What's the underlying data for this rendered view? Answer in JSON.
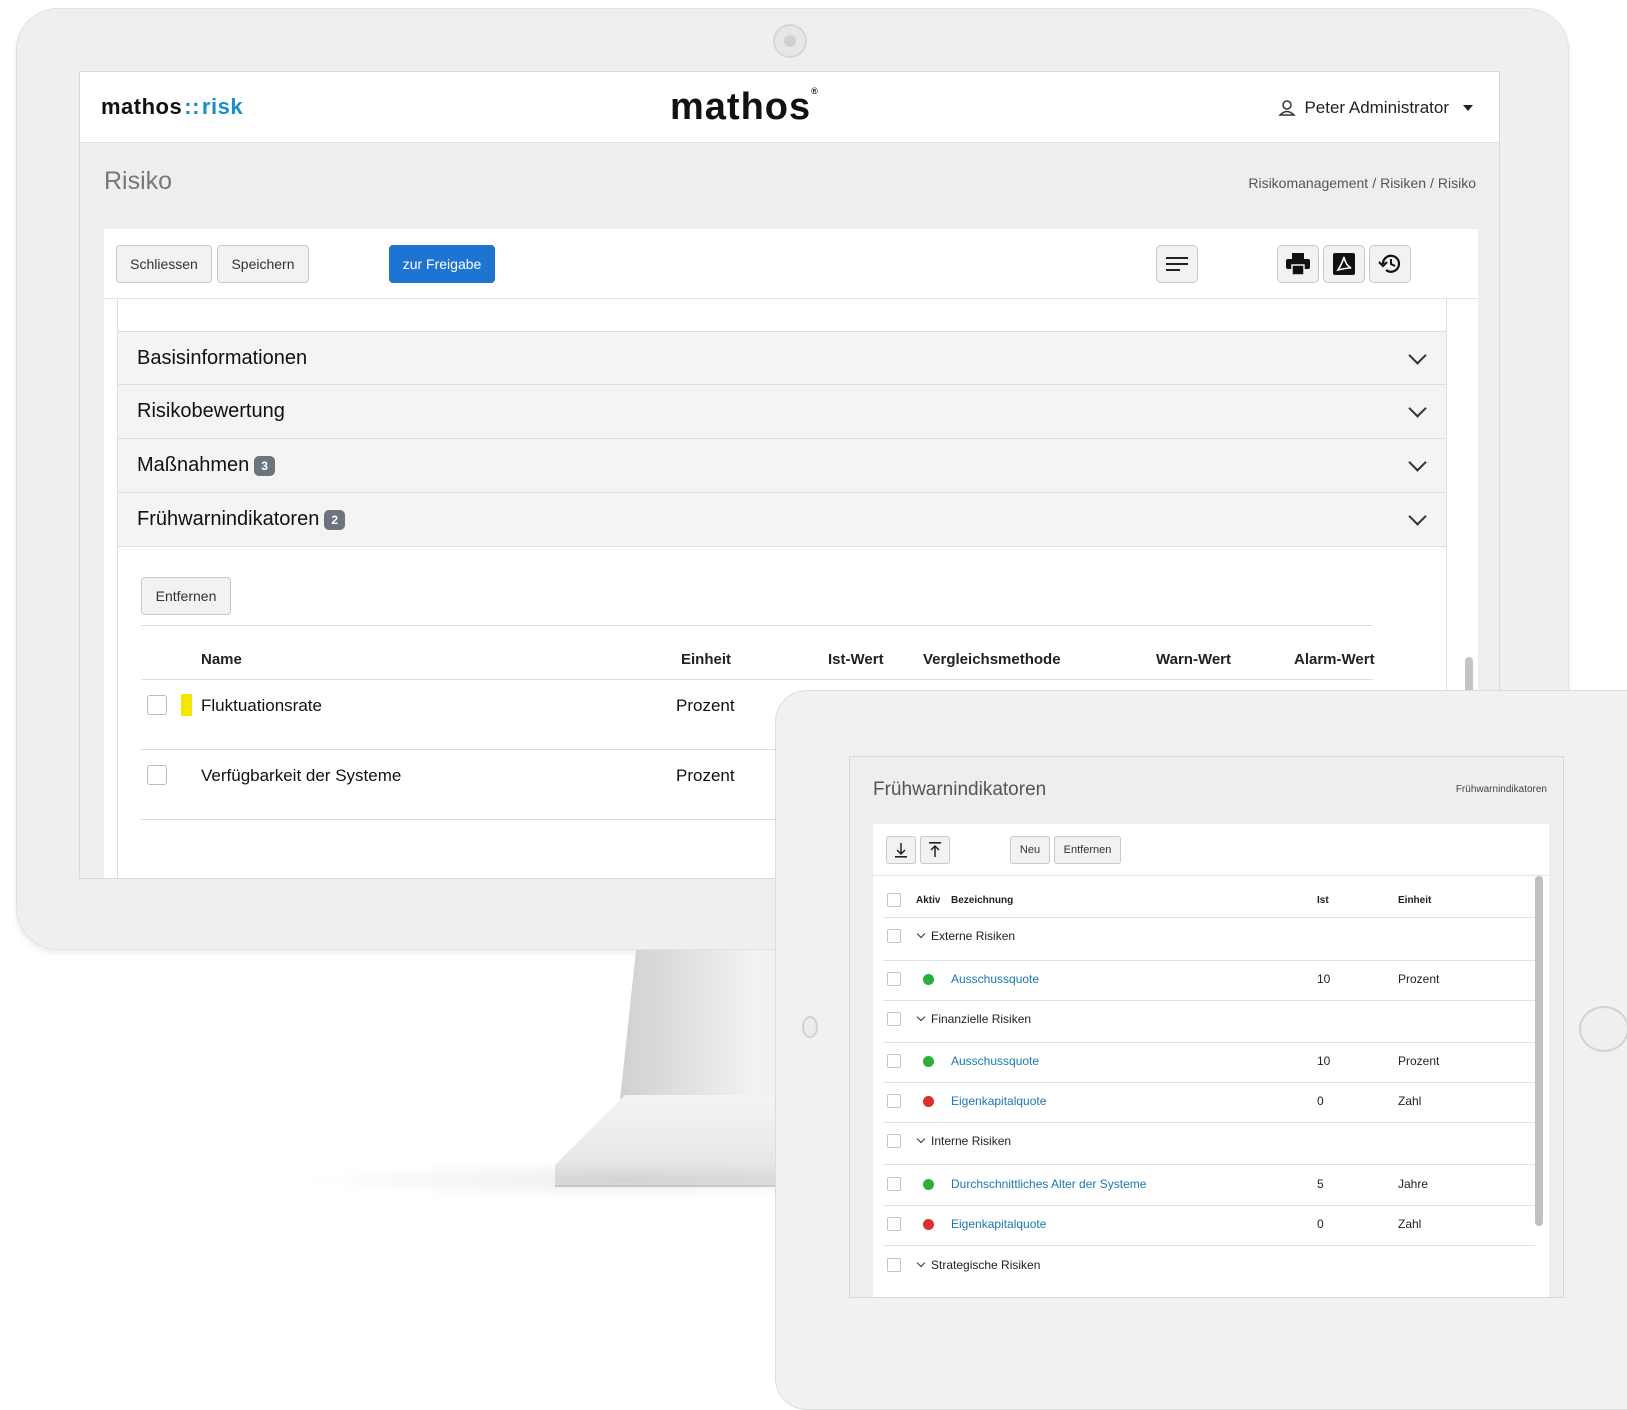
{
  "desktop": {
    "brand": {
      "left": "mathos",
      "sep": "::",
      "right": "risk"
    },
    "center_logo": "mathos",
    "user": "Peter Administrator",
    "page_title": "Risiko",
    "breadcrumb": [
      "Risikomanagement",
      "Risiken",
      "Risiko"
    ],
    "toolbar": {
      "close": "Schliessen",
      "save": "Speichern",
      "release": "zur Freigabe"
    },
    "toolbar_icons": [
      "menu-icon",
      "printer-icon",
      "pdf-icon",
      "history-icon"
    ],
    "sections": [
      {
        "label": "Basisinformationen",
        "badge": ""
      },
      {
        "label": "Risikobewertung",
        "badge": ""
      },
      {
        "label": "Maßnahmen",
        "badge": "3"
      },
      {
        "label": "Frühwarnindikatoren",
        "badge": "2"
      }
    ],
    "remove_button": "Entfernen",
    "table": {
      "columns": [
        "Name",
        "Einheit",
        "Ist-Wert",
        "Vergleichsmethode",
        "Warn-Wert",
        "Alarm-Wert"
      ],
      "rows": [
        {
          "name": "Fluktuationsrate",
          "unit": "Prozent",
          "marker": "yellow"
        },
        {
          "name": "Verfügbarkeit der Systeme",
          "unit": "Prozent",
          "marker": ""
        }
      ]
    }
  },
  "tablet": {
    "title": "Frühwarnindikatoren",
    "breadcrumb": "Frühwarnindikatoren",
    "toolbar": {
      "new": "Neu",
      "remove": "Entfernen"
    },
    "toolbar_icons": [
      "download-icon",
      "upload-icon"
    ],
    "columns": {
      "active": "Aktiv",
      "name": "Bezeichnung",
      "actual": "Ist",
      "unit": "Einheit"
    },
    "groups": [
      {
        "label": "Externe Risiken",
        "items": [
          {
            "name": "Ausschussquote",
            "actual": "10",
            "unit": "Prozent",
            "status": "green"
          }
        ]
      },
      {
        "label": "Finanzielle Risiken",
        "items": [
          {
            "name": "Ausschussquote",
            "actual": "10",
            "unit": "Prozent",
            "status": "green"
          },
          {
            "name": "Eigenkapitalquote",
            "actual": "0",
            "unit": "Zahl",
            "status": "red"
          }
        ]
      },
      {
        "label": "Interne Risiken",
        "items": [
          {
            "name": "Durchschnittliches Alter der Systeme",
            "actual": "5",
            "unit": "Jahre",
            "status": "green"
          },
          {
            "name": "Eigenkapitalquote",
            "actual": "0",
            "unit": "Zahl",
            "status": "red"
          }
        ]
      },
      {
        "label": "Strategische Risiken",
        "items": []
      }
    ]
  },
  "colors": {
    "accent": "#1d75d1",
    "link": "#1a78b8",
    "brand": "#1a8fc4",
    "status_green": "#27b03a",
    "status_red": "#d9302c",
    "marker_yellow": "#f5e600"
  }
}
